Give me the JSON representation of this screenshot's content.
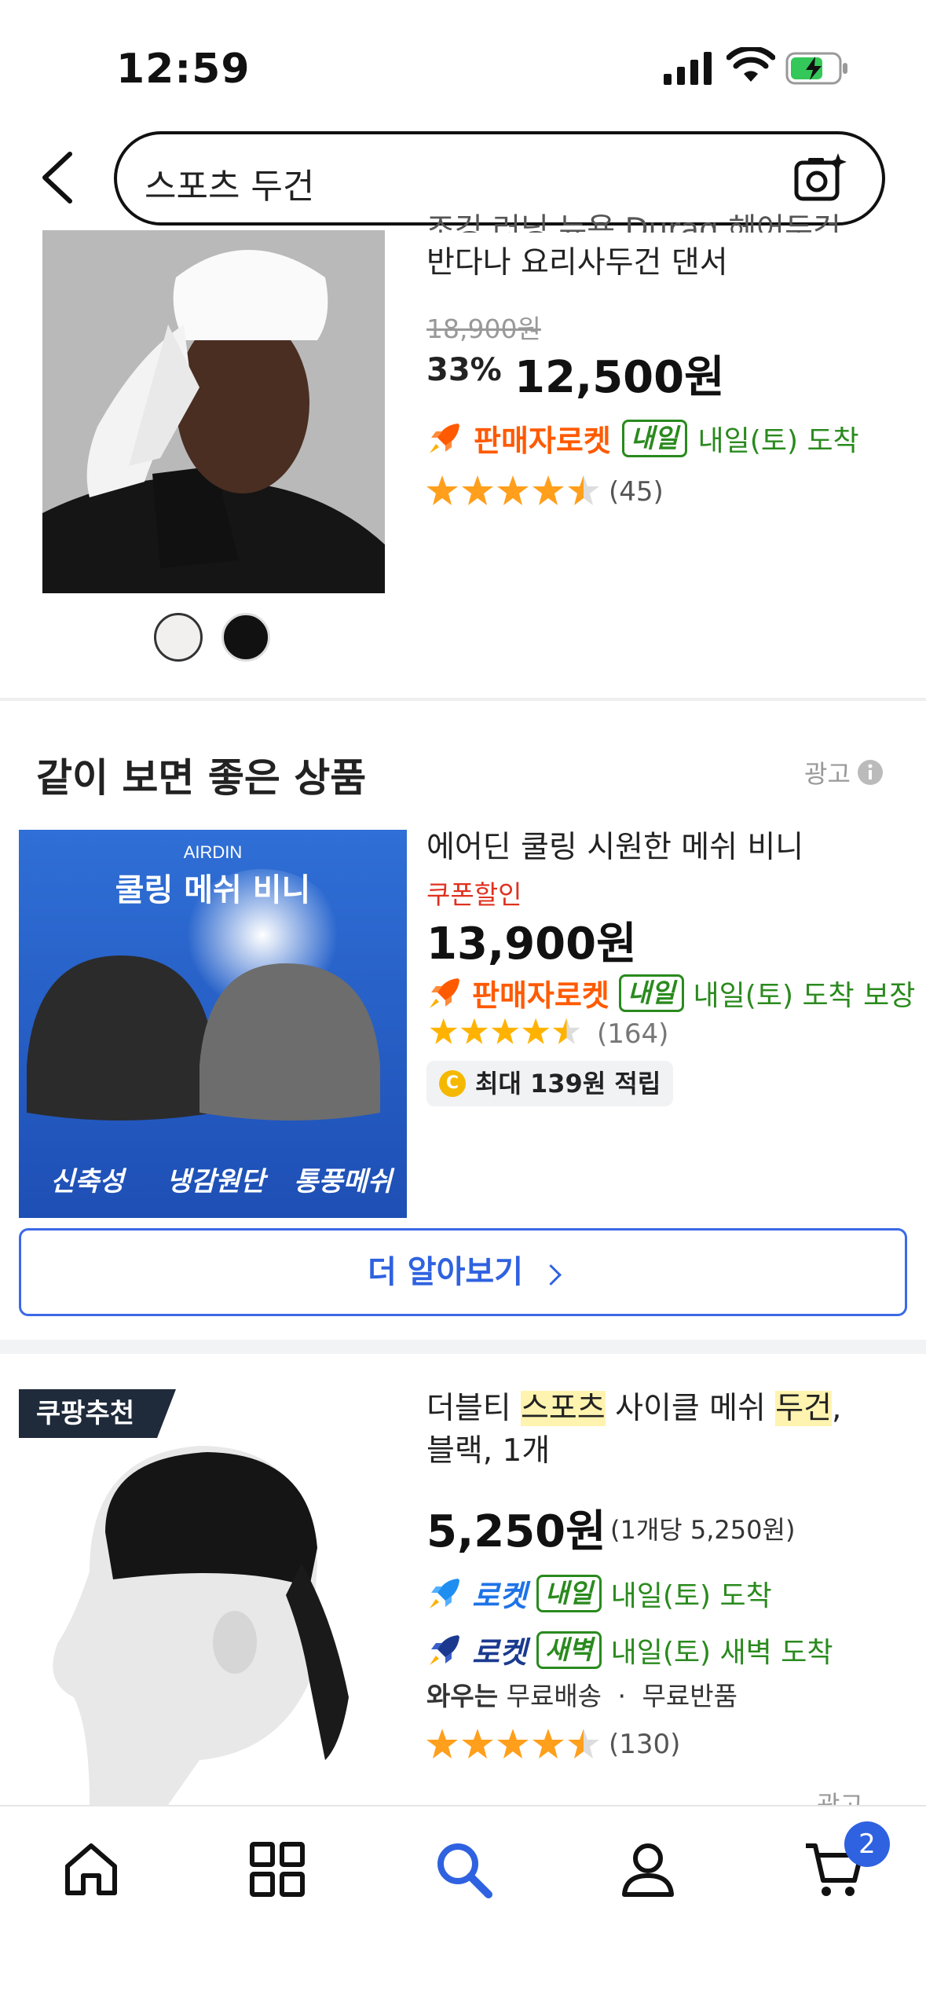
{
  "status": {
    "time": "12:59"
  },
  "search": {
    "query": "스포츠 두건"
  },
  "product1": {
    "title_partial": "조깅 러닝 뉴욕 Durag 헤어두건",
    "title_line2": "반다나 요리사두건 댄서",
    "original_price": "18,900원",
    "discount": "33%",
    "price": "12,500원",
    "rocket_label": "판매자로켓",
    "badge": "내일",
    "delivery": "내일(토) 도착",
    "rating": 4.5,
    "review_count": "(45)"
  },
  "section": {
    "title": "같이 보면 좋은 상품",
    "ad_label": "광고"
  },
  "product2": {
    "image_brand": "AIRDIN",
    "image_title": "쿨링 메쉬 비니",
    "image_features": [
      "신축성",
      "냉감원단",
      "통풍메쉬"
    ],
    "title": "에어딘 쿨링 시원한 메쉬 비니",
    "coupon": "쿠폰할인",
    "price": "13,900원",
    "rocket_label": "판매자로켓",
    "badge": "내일",
    "delivery": "내일(토) 도착 보장",
    "rating": 4.5,
    "review_count": "(164)",
    "cashback_icon": "C",
    "cashback": "최대 139원 적립",
    "more_button": "더 알아보기"
  },
  "product3": {
    "rec_badge": "쿠팡추천",
    "title_parts": [
      "더블티 ",
      "스포츠",
      " 사이클 메쉬 ",
      "두건",
      ","
    ],
    "title_line2": "블랙, 1개",
    "price": "5,250원",
    "unit_price": "(1개당 5,250원)",
    "rocket1_label": "로켓",
    "rocket1_badge": "내일",
    "rocket1_delivery": "내일(토) 도착",
    "rocket2_label": "로켓",
    "rocket2_badge": "새벽",
    "rocket2_delivery": "내일(토) 새벽 도착",
    "wow_bold": "와우는",
    "wow_text": "무료배송",
    "wow_text2": "무료반품",
    "rating": 4.5,
    "review_count": "(130)",
    "ad_label": "광고"
  },
  "nav": {
    "items": [
      "home-icon",
      "category-icon",
      "search-icon",
      "my-page-icon",
      "cart-icon"
    ],
    "cart_count": "2"
  }
}
